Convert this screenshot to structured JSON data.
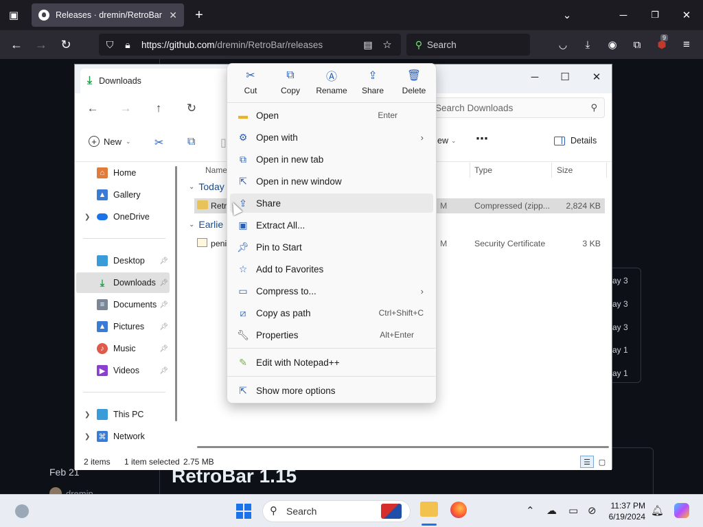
{
  "browser": {
    "tab_title": "Releases · dremin/RetroBar",
    "url_host": "https://github.com",
    "url_path": "/dremin/RetroBar/releases",
    "search_placeholder": "Search",
    "extensions_badge": "9"
  },
  "github": {
    "day_labels": [
      "ay 3",
      "ay 3",
      "ay 3",
      "ay 1",
      "ay 1"
    ],
    "release_heading": "RetroBar 1.15",
    "release_date": "Feb 21",
    "release_author": "dremin"
  },
  "explorer": {
    "tab_title": "Downloads",
    "search_placeholder": "Search Downloads",
    "toolbar": {
      "new_label": "New",
      "view_label": "ew",
      "details_label": "Details"
    },
    "sidebar": [
      {
        "label": "Home",
        "icon": "home-icon",
        "color": "#e07b39"
      },
      {
        "label": "Gallery",
        "icon": "gallery-icon",
        "color": "#3a7bd5"
      },
      {
        "label": "OneDrive",
        "icon": "cloud-icon",
        "color": "#1a73e8"
      },
      {
        "label": "Desktop",
        "icon": "desktop-icon",
        "color": "#3a9bd9"
      },
      {
        "label": "Downloads",
        "icon": "download-icon",
        "color": "#1e9e4a"
      },
      {
        "label": "Documents",
        "icon": "document-icon",
        "color": "#7a8797"
      },
      {
        "label": "Pictures",
        "icon": "pictures-icon",
        "color": "#3a7bd5"
      },
      {
        "label": "Music",
        "icon": "music-icon",
        "color": "#e05a4a"
      },
      {
        "label": "Videos",
        "icon": "video-icon",
        "color": "#8a3fd1"
      },
      {
        "label": "This PC",
        "icon": "computer-icon",
        "color": "#3a9bd9"
      },
      {
        "label": "Network",
        "icon": "network-icon",
        "color": "#3a7bd5"
      }
    ],
    "columns": {
      "name": "Name",
      "type": "Type",
      "size": "Size"
    },
    "groups": {
      "today": "Today",
      "earlier": "Earlie"
    },
    "files": [
      {
        "name": "Retr",
        "date_tail": "M",
        "type": "Compressed (zipp...",
        "size": "2,824 KB"
      },
      {
        "name": "peni",
        "date_tail": "M",
        "type": "Security Certificate",
        "size": "3 KB"
      }
    ],
    "status": {
      "items": "2 items",
      "selected": "1 item selected",
      "size": "2.75 MB"
    }
  },
  "context_menu": {
    "quick_actions": [
      {
        "label": "Cut",
        "icon": "scissors-icon"
      },
      {
        "label": "Copy",
        "icon": "copy-icon"
      },
      {
        "label": "Rename",
        "icon": "rename-icon"
      },
      {
        "label": "Share",
        "icon": "share-icon"
      },
      {
        "label": "Delete",
        "icon": "trash-icon"
      }
    ],
    "items": [
      {
        "label": "Open",
        "shortcut": "Enter",
        "icon": "folder-icon"
      },
      {
        "label": "Open with",
        "shortcut": "",
        "icon": "open-with-icon",
        "submenu": true
      },
      {
        "label": "Open in new tab",
        "shortcut": "",
        "icon": "new-tab-icon"
      },
      {
        "label": "Open in new window",
        "shortcut": "",
        "icon": "new-window-icon"
      },
      {
        "label": "Share",
        "shortcut": "",
        "icon": "share-icon"
      },
      {
        "label": "Extract All...",
        "shortcut": "",
        "icon": "extract-icon"
      },
      {
        "label": "Pin to Start",
        "shortcut": "",
        "icon": "pin-icon"
      },
      {
        "label": "Add to Favorites",
        "shortcut": "",
        "icon": "star-icon"
      },
      {
        "label": "Compress to...",
        "shortcut": "",
        "icon": "compress-icon",
        "submenu": true
      },
      {
        "label": "Copy as path",
        "shortcut": "Ctrl+Shift+C",
        "icon": "copy-path-icon"
      },
      {
        "label": "Properties",
        "shortcut": "Alt+Enter",
        "icon": "wrench-icon"
      },
      {
        "label": "Edit with Notepad++",
        "shortcut": "",
        "icon": "notepad-icon"
      },
      {
        "label": "Show more options",
        "shortcut": "",
        "icon": "more-options-icon"
      }
    ]
  },
  "taskbar": {
    "search_label": "Search",
    "time": "11:37 PM",
    "date": "6/19/2024"
  }
}
